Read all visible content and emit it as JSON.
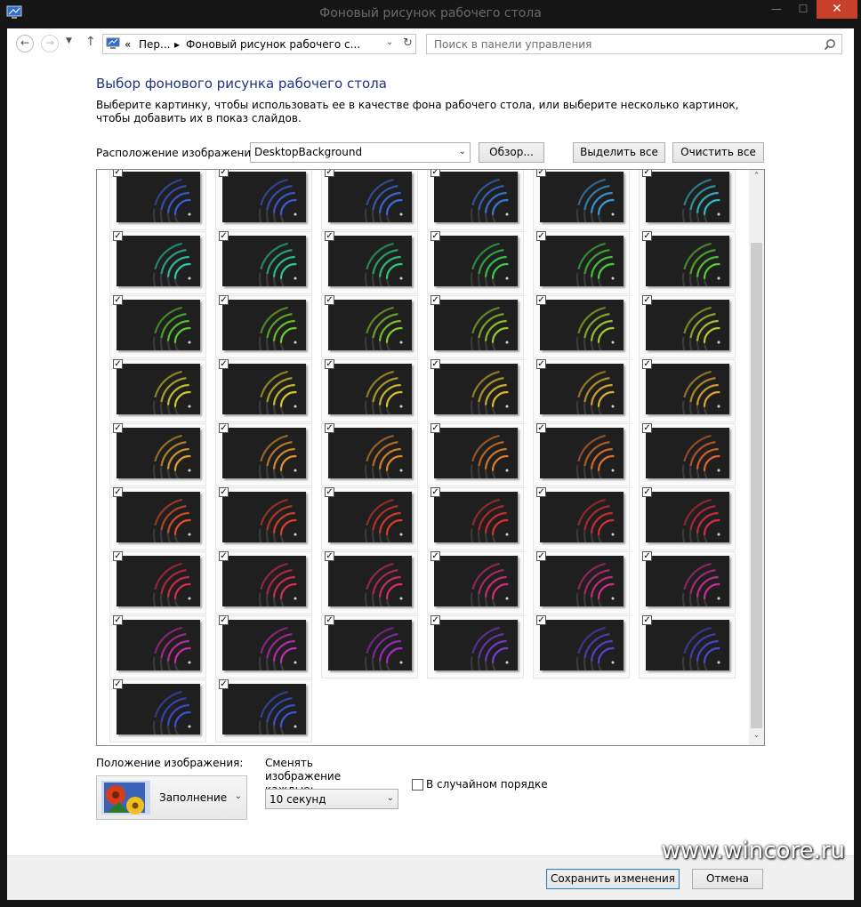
{
  "window": {
    "title": "Фоновый рисунок рабочего стола",
    "minimize_glyph": "—",
    "maximize_glyph": "☐",
    "close_glyph": "✕"
  },
  "nav": {
    "back_glyph": "←",
    "forward_glyph": "→",
    "recent_glyph": "▼",
    "up_glyph": "↑",
    "address": {
      "chevron_prefix": "«",
      "crumb1": "Пер...",
      "chevron": "▸",
      "crumb2": "Фоновый рисунок рабочего с...",
      "dropdown_glyph": "⌄",
      "refresh_glyph": "↻"
    },
    "search": {
      "placeholder": "Поиск в панели управления",
      "icon": "search-icon"
    }
  },
  "header": {
    "title": "Выбор фонового рисунка рабочего стола",
    "description": "Выберите картинку, чтобы использовать ее в качестве фона рабочего стола, или выберите несколько картинок, чтобы добавить их в показ слайдов."
  },
  "location": {
    "label": "Расположение изображения:",
    "value": "DesktopBackground",
    "dropdown_glyph": "⌄",
    "browse_label": "Обзор...",
    "select_all_label": "Выделить все",
    "clear_all_label": "Очистить все"
  },
  "gallery": {
    "checkmark": "✓",
    "scroll_up_glyph": "⌃",
    "scroll_down_glyph": "⌄",
    "columns": 6,
    "images": [
      {
        "color": "#3a5cd8",
        "checked": true
      },
      {
        "color": "#3a5cd8",
        "checked": true
      },
      {
        "color": "#3a6ad8",
        "checked": true
      },
      {
        "color": "#3a78d8",
        "checked": true
      },
      {
        "color": "#3a9ad8",
        "checked": true
      },
      {
        "color": "#33b8c8",
        "checked": true
      },
      {
        "color": "#2cc8a4",
        "checked": true
      },
      {
        "color": "#2cc890",
        "checked": true
      },
      {
        "color": "#2cc878",
        "checked": true
      },
      {
        "color": "#38cc4c",
        "checked": true
      },
      {
        "color": "#48cc3c",
        "checked": true
      },
      {
        "color": "#58cc36",
        "checked": true
      },
      {
        "color": "#5ccc2e",
        "checked": true
      },
      {
        "color": "#6ccc2c",
        "checked": true
      },
      {
        "color": "#80cc2c",
        "checked": true
      },
      {
        "color": "#94cc2c",
        "checked": true
      },
      {
        "color": "#a8cc2c",
        "checked": true
      },
      {
        "color": "#b8cc2c",
        "checked": true
      },
      {
        "color": "#cccc2c",
        "checked": true
      },
      {
        "color": "#d4c82c",
        "checked": true
      },
      {
        "color": "#d8c02c",
        "checked": true
      },
      {
        "color": "#dcb82c",
        "checked": true
      },
      {
        "color": "#dcb02c",
        "checked": true
      },
      {
        "color": "#dca82c",
        "checked": true
      },
      {
        "color": "#e0a02c",
        "checked": true
      },
      {
        "color": "#e0942c",
        "checked": true
      },
      {
        "color": "#e0882c",
        "checked": true
      },
      {
        "color": "#e07c2c",
        "checked": true
      },
      {
        "color": "#e0702c",
        "checked": true
      },
      {
        "color": "#e0642c",
        "checked": true
      },
      {
        "color": "#e0502c",
        "checked": true
      },
      {
        "color": "#dc402c",
        "checked": true
      },
      {
        "color": "#dc382c",
        "checked": true
      },
      {
        "color": "#d8302c",
        "checked": true
      },
      {
        "color": "#d82c34",
        "checked": true
      },
      {
        "color": "#d82c40",
        "checked": true
      },
      {
        "color": "#d82c4c",
        "checked": true
      },
      {
        "color": "#d82c58",
        "checked": true
      },
      {
        "color": "#d82c66",
        "checked": true
      },
      {
        "color": "#d42c74",
        "checked": true
      },
      {
        "color": "#d02c84",
        "checked": true
      },
      {
        "color": "#cc2c94",
        "checked": true
      },
      {
        "color": "#c82ca4",
        "checked": true
      },
      {
        "color": "#c02cb4",
        "checked": true
      },
      {
        "color": "#a02cc4",
        "checked": true
      },
      {
        "color": "#7a3cd0",
        "checked": true
      },
      {
        "color": "#5c40d4",
        "checked": true
      },
      {
        "color": "#4848d8",
        "checked": true
      },
      {
        "color": "#3a50d8",
        "checked": true
      },
      {
        "color": "#3a56d8",
        "checked": true
      }
    ]
  },
  "position": {
    "label": "Положение изображения:",
    "value": "Заполнение",
    "dropdown_glyph": "⌄"
  },
  "interval": {
    "label": "Сменять изображение каждые:",
    "value": "10 секунд",
    "dropdown_glyph": "⌄"
  },
  "shuffle": {
    "label": "В случайном порядке",
    "checked": false
  },
  "footer": {
    "save_label": "Сохранить изменения",
    "cancel_label": "Отмена"
  },
  "watermark": "www.wincore.ru"
}
